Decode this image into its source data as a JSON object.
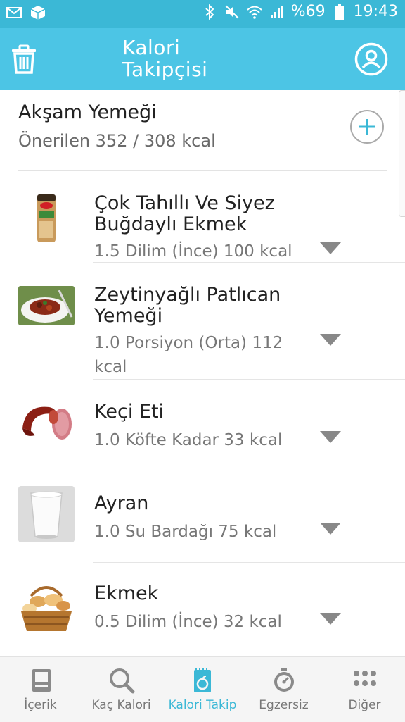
{
  "status_bar": {
    "battery_percent": "%69",
    "time": "19:43",
    "icons": [
      "mail-icon",
      "package-icon",
      "bluetooth-icon",
      "mute-icon",
      "wifi-icon",
      "signal-icon",
      "battery-icon"
    ]
  },
  "app_bar": {
    "title": "Kalori Takipçisi",
    "left_icon": "trash-icon",
    "right_icon": "profile-icon"
  },
  "meal": {
    "name": "Akşam Yemeği",
    "recommended": "Önerilen 352 / 308 kcal",
    "add_icon": "plus-icon"
  },
  "foods": [
    {
      "name": "Çok Tahıllı Ve Siyez Buğdaylı Ekmek",
      "desc": "1.5 Dilim (İnce) 100 kcal",
      "image": "bread-package-image"
    },
    {
      "name": "Zeytinyağlı Patlıcan Yemeği",
      "desc": "1.0 Porsiyon (Orta) 112 kcal",
      "image": "eggplant-dish-image"
    },
    {
      "name": "Keçi Eti",
      "desc": "1.0 Köfte Kadar 33 kcal",
      "image": "sausage-image"
    },
    {
      "name": "Ayran",
      "desc": "1.0 Su Bardağı 75 kcal",
      "image": "ayran-glass-image"
    },
    {
      "name": "Ekmek",
      "desc": "0.5 Dilim (İnce) 32 kcal",
      "image": "bread-basket-image"
    }
  ],
  "bottom_nav": [
    {
      "label": "İçerik",
      "icon": "book-icon",
      "active": false
    },
    {
      "label": "Kaç Kalori",
      "icon": "search-icon",
      "active": false
    },
    {
      "label": "Kalori Takip",
      "icon": "notepad-apple-icon",
      "active": true
    },
    {
      "label": "Egzersiz",
      "icon": "stopwatch-icon",
      "active": false
    },
    {
      "label": "Diğer",
      "icon": "grid-icon",
      "active": false
    }
  ],
  "colors": {
    "app_bar": "#4cc5e5",
    "status_bar": "#3bb8d6",
    "accent": "#3bb8d6"
  }
}
